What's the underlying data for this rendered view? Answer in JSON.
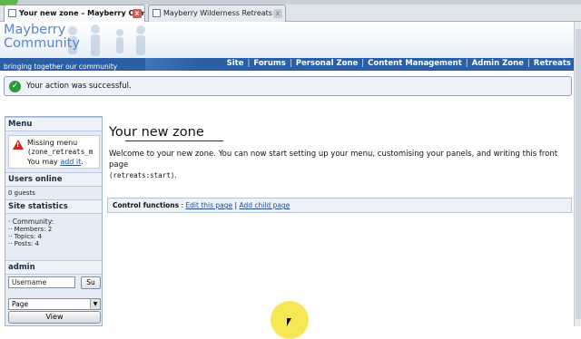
{
  "browser": {
    "tabs": [
      {
        "title": "Your new zone – Mayberry Comm...",
        "active": true
      },
      {
        "title": "Mayberry Wilderness Retreats",
        "active": false
      }
    ],
    "close_glyph": "x"
  },
  "header": {
    "site_title_line1": "Mayberry",
    "site_title_line2": "Community",
    "tagline": "bringing together our community",
    "nav": [
      "Site",
      "Forums",
      "Personal Zone",
      "Content Management",
      "Admin Zone",
      "Retreats"
    ],
    "nav_separator": "|"
  },
  "message": {
    "icon": "check-circle-icon",
    "text": "Your action was successful."
  },
  "sidebar": {
    "menu": {
      "title": "Menu",
      "warning_line1": "Missing menu",
      "warning_code": "(zone_retreats_m",
      "warning_prefix": "You may",
      "warning_link": "add it",
      "warning_suffix": "."
    },
    "users_online": {
      "title": "Users online",
      "value": "0 guests"
    },
    "site_statistics": {
      "title": "Site statistics",
      "community_label": "· Community:",
      "members": "·· Members: 2",
      "topics": "·· Topics: 4",
      "posts": "·· Posts: 4"
    },
    "admin": {
      "title": "admin",
      "username_value": "Username",
      "submit_label": "Su",
      "select_value": "Page",
      "view_label": "View"
    }
  },
  "main": {
    "title": "Your new zone",
    "intro_text": "Welcome to your new zone. You can now start setting up your menu, customising your panels, and writing this front page",
    "intro_code": "(retreats:start)",
    "intro_end": ".",
    "control_label": "Control functions",
    "control_colon": ":",
    "control_links": [
      "Edit this page",
      "Add child page"
    ],
    "control_separator": "|"
  },
  "colors": {
    "navbar": "#2a5ea5",
    "site_title": "#5b86c6",
    "success": "#2c9a3b",
    "warning": "#c62828",
    "link": "#1d4f9a",
    "cursor_highlight": "#f5e642"
  }
}
